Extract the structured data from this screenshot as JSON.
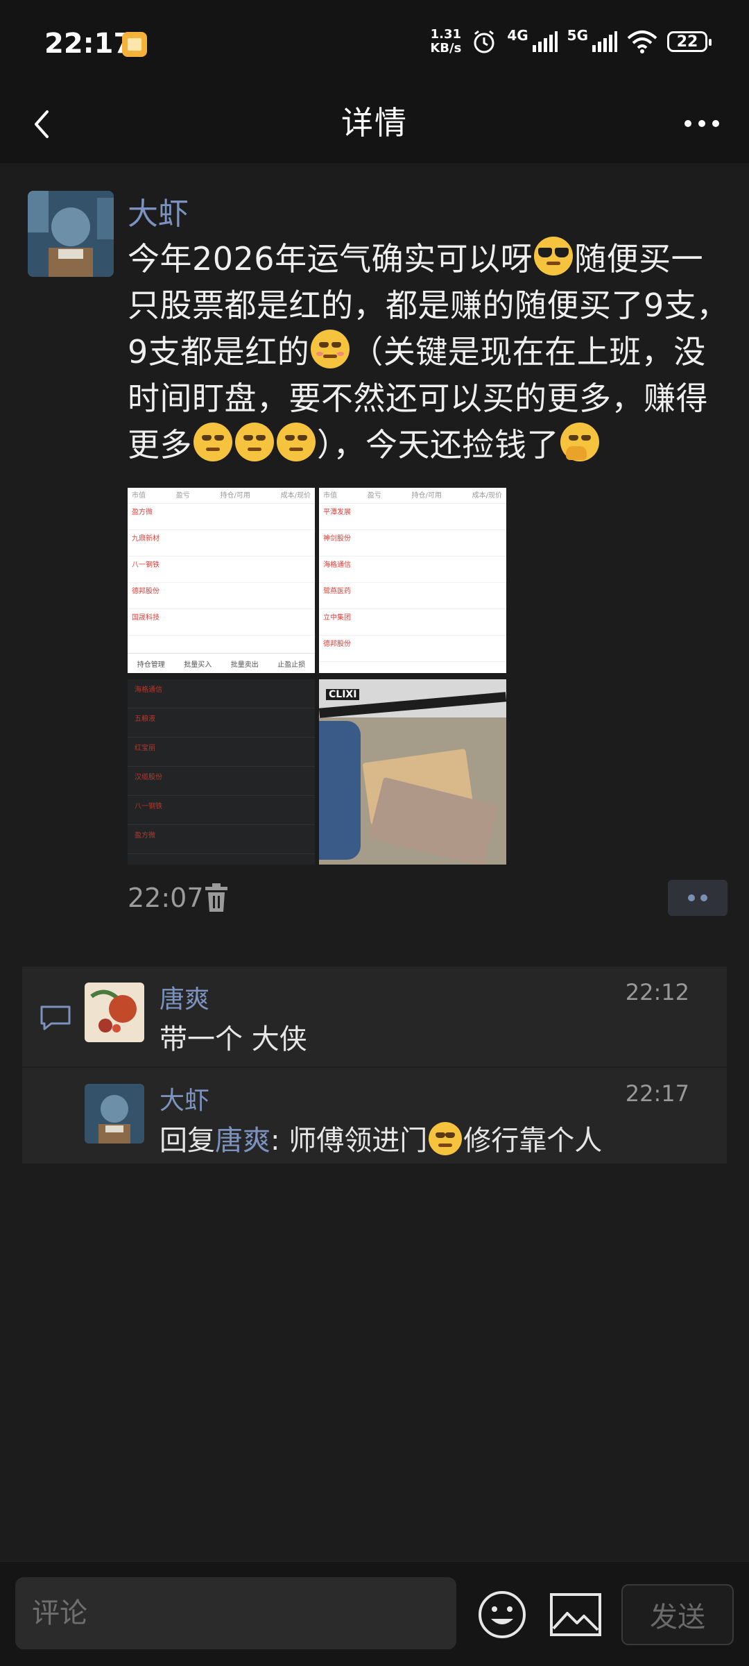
{
  "status_bar": {
    "time": "22:17",
    "net_speed_value": "1.31",
    "net_speed_unit": "KB/s",
    "signal_1": "4G",
    "signal_2": "5G",
    "battery": "22"
  },
  "header": {
    "title": "详情"
  },
  "post": {
    "author": "大虾",
    "text_1": "今年2026年运气确实可以呀",
    "text_2": "随便买一只股票都是红的，都是赚的随便买了9支，9支都是红的",
    "text_3": "（关键是现在在上班，没时间盯盘，要不然还可以买的更多，赚得更多",
    "text_4": "），今天还捡钱了",
    "time": "22:07",
    "photos": {
      "p1": {
        "header": [
          "市值",
          "盈亏",
          "持仓/可用",
          "成本/现价"
        ],
        "rows": [
          "盈方微",
          "九鼎新材",
          "八一钢铁",
          "德邦股份",
          "国晟科技"
        ],
        "footer": [
          "持仓管理",
          "批量买入",
          "批量卖出",
          "止盈止损"
        ]
      },
      "p2": {
        "header": [
          "市值",
          "盈亏",
          "持仓/可用",
          "成本/现价"
        ],
        "rows": [
          "平潭发展",
          "神剑股份",
          "海格通信",
          "鹭燕医药",
          "立中集团",
          "德邦股份"
        ]
      },
      "p3": {
        "rows": [
          "海格通信",
          "五粮液",
          "红宝丽",
          "汉缆股份",
          "八一钢铁",
          "盈方微"
        ]
      },
      "p4": {
        "brand": "CLIXI"
      }
    }
  },
  "comments": [
    {
      "name": "唐爽",
      "time": "22:12",
      "text": "带一个 大侠"
    },
    {
      "name": "大虾",
      "time": "22:17",
      "reply_prefix": "回复",
      "reply_to": "唐爽",
      "text_1": ": 师傅领进门",
      "text_2": "修行靠个人"
    }
  ],
  "bottom_bar": {
    "input_placeholder": "评论",
    "send_label": "发送"
  },
  "icons": {
    "back": "chevron-left-icon",
    "more": "more-dots-icon",
    "delete": "trash-icon",
    "comment": "comment-bubble-icon",
    "emoji": "smiley-icon",
    "image": "image-icon"
  },
  "colors": {
    "background": "#1c1c1c",
    "name_link": "#7c93c0",
    "text": "#efefef",
    "muted": "#9b9b9b"
  }
}
